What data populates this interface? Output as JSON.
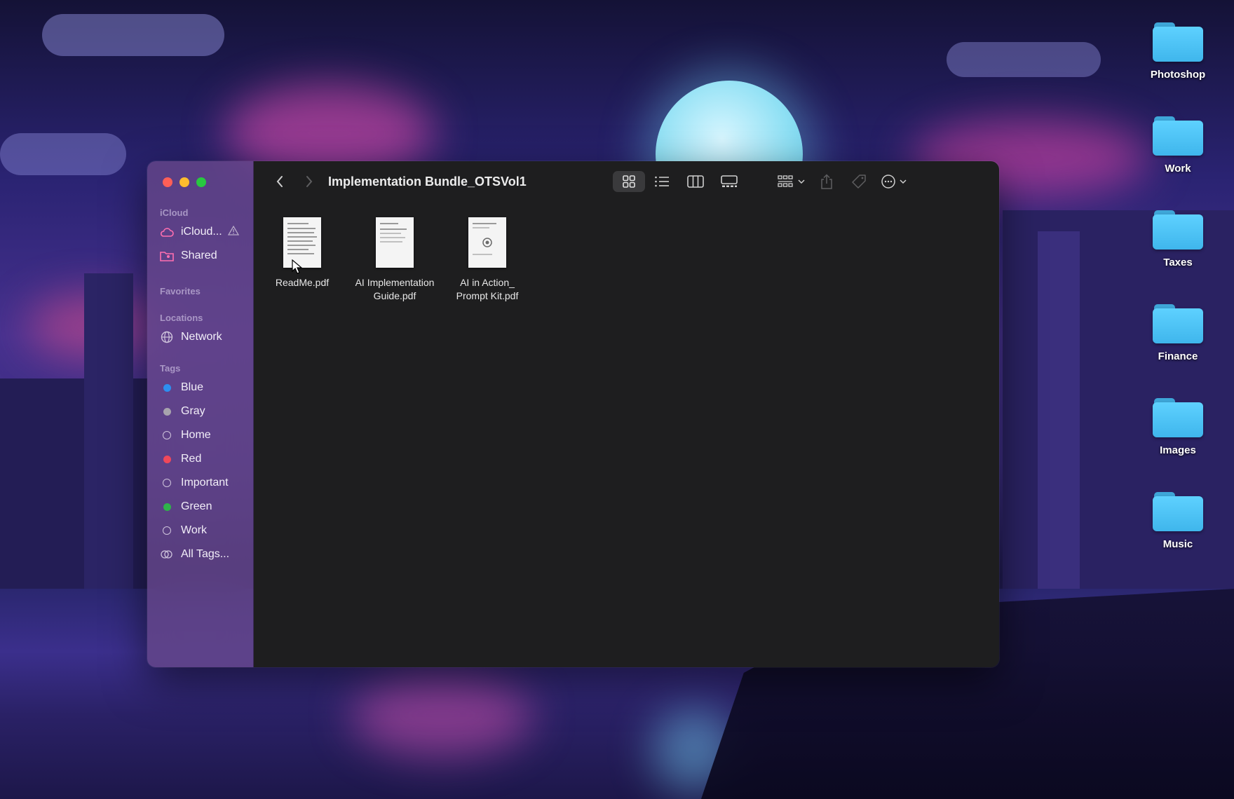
{
  "window": {
    "title": "Implementation Bundle_OTSVol1"
  },
  "sidebar": {
    "sections": {
      "icloud": "iCloud",
      "favorites": "Favorites",
      "locations": "Locations",
      "tags": "Tags"
    },
    "icloud_items": [
      {
        "label": "iCloud...",
        "icon": "cloud-icon",
        "has_warning": true
      },
      {
        "label": "Shared",
        "icon": "shared-folder-icon"
      }
    ],
    "location_items": [
      {
        "label": "Network",
        "icon": "globe-icon"
      }
    ],
    "tag_items": [
      {
        "label": "Blue",
        "color": "#2d8ff0",
        "style": "dot"
      },
      {
        "label": "Gray",
        "color": "#a7a3ad",
        "style": "dot"
      },
      {
        "label": "Home",
        "color": "",
        "style": "ring"
      },
      {
        "label": "Red",
        "color": "#f0485a",
        "style": "dot"
      },
      {
        "label": "Important",
        "color": "",
        "style": "ring"
      },
      {
        "label": "Green",
        "color": "#2fb34a",
        "style": "dot"
      },
      {
        "label": "Work",
        "color": "",
        "style": "ring"
      },
      {
        "label": "All Tags...",
        "color": "",
        "style": "all-tags"
      }
    ]
  },
  "toolbar": {
    "icons": [
      "back-icon",
      "forward-icon",
      "icon-view-icon",
      "list-view-icon",
      "column-view-icon",
      "gallery-view-icon",
      "group-by-icon",
      "share-icon",
      "tag-icon",
      "more-actions-icon",
      "search-icon"
    ],
    "active_view": "icon-view"
  },
  "files": [
    {
      "name_line1": "ReadMe.pdf",
      "name_line2": ""
    },
    {
      "name_line1": "AI Implementation",
      "name_line2": "Guide.pdf"
    },
    {
      "name_line1": "AI in Action_",
      "name_line2": "Prompt Kit.pdf"
    }
  ],
  "desktop_folders": [
    {
      "label": "Photoshop"
    },
    {
      "label": "Work"
    },
    {
      "label": "Taxes"
    },
    {
      "label": "Finance"
    },
    {
      "label": "Images"
    },
    {
      "label": "Music"
    }
  ],
  "colors": {
    "sidebar_bg": "#68488a",
    "content_bg": "#1e1e1f",
    "folder_blue": "#4fc3f7",
    "traffic_red": "#ff5f57",
    "traffic_yellow": "#febc2e",
    "traffic_green": "#28c840"
  }
}
